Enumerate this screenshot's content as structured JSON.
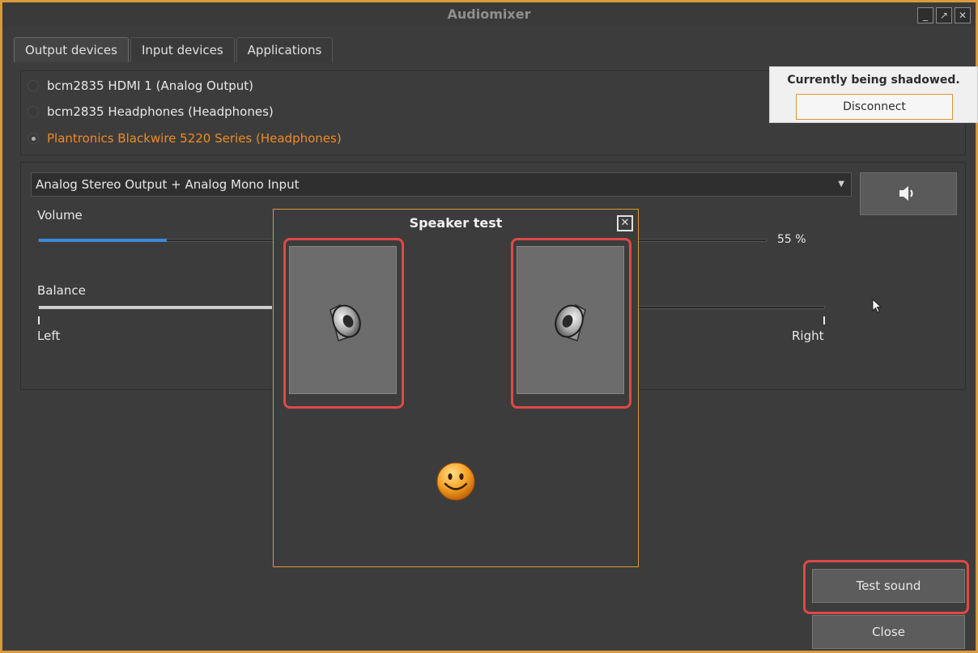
{
  "window": {
    "title": "Audiomixer",
    "controls": [
      "minimize",
      "maximize",
      "close"
    ]
  },
  "tabs": [
    {
      "label": "Output devices",
      "active": true
    },
    {
      "label": "Input devices",
      "active": false
    },
    {
      "label": "Applications",
      "active": false
    }
  ],
  "devices": [
    {
      "label": "bcm2835 HDMI 1 (Analog Output)",
      "selected": false
    },
    {
      "label": "bcm2835 Headphones (Headphones)",
      "selected": false
    },
    {
      "label": "Plantronics Blackwire 5220 Series (Headphones)",
      "selected": true
    }
  ],
  "shadow_notice": {
    "title": "Currently being shadowed.",
    "button": "Disconnect"
  },
  "profile": {
    "selected": "Analog Stereo Output + Analog Mono Input"
  },
  "volume": {
    "label": "Volume",
    "value_text": "55 %",
    "value": 55
  },
  "balance": {
    "label": "Balance",
    "left_label": "Left",
    "right_label": "Right"
  },
  "buttons": {
    "test_sound": "Test sound",
    "close": "Close"
  },
  "speaker_test": {
    "title": "Speaker test",
    "close_symbol": "✕"
  },
  "colors": {
    "accent": "#d99a3c",
    "selected_text": "#f08a24",
    "slider": "#3a8ad8",
    "highlight": "#e04848"
  },
  "icons": [
    "speaker-volume-icon",
    "speaker-icon",
    "smiley-icon",
    "mouse-cursor-icon"
  ]
}
